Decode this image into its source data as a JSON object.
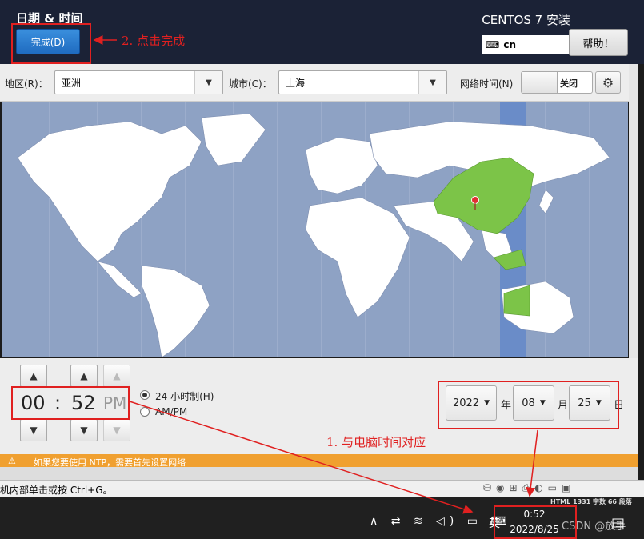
{
  "header": {
    "title": "日期 & 时间",
    "product": "CENTOS 7 安装",
    "done_label": "完成(D)",
    "keyboard_layout": "cn",
    "help_label": "帮助！"
  },
  "toolbar": {
    "region_label": "地区(R)：",
    "region_value": "亚洲",
    "city_label": "城市(C)：",
    "city_value": "上海",
    "network_time_label": "网络时间(N)",
    "network_time_state": "关闭"
  },
  "map": {
    "selected_region_color": "#7cc448",
    "ocean_color": "#8ea2c4",
    "land_color": "#ffffff",
    "timezone_band_color": "#6a8cc8",
    "pin_color": "#e03030"
  },
  "time": {
    "hours": "00",
    "separator": ":",
    "minutes": "52",
    "ampm": "PM",
    "format_24h_label": "24 小时制(H)",
    "format_ampm_label": "AM/PM",
    "selected_format": "24h"
  },
  "date": {
    "year": "2022",
    "year_unit": "年",
    "month": "08",
    "month_unit": "月",
    "day": "25",
    "day_unit": "日"
  },
  "warning": {
    "text": "如果您要使用 NTP，需要首先设置网络"
  },
  "vm_status": {
    "hint": "机内部单击或按 Ctrl+G。",
    "info": "HTML  1331 字数  66 段落"
  },
  "taskbar": {
    "ime": "英",
    "time": "0:52",
    "date": "2022/8/25",
    "watermark": "CSDN @放手"
  },
  "annotations": {
    "step1": "1. 与电脑时间对应",
    "step2": "2. 点击完成",
    "color": "#e02020"
  }
}
